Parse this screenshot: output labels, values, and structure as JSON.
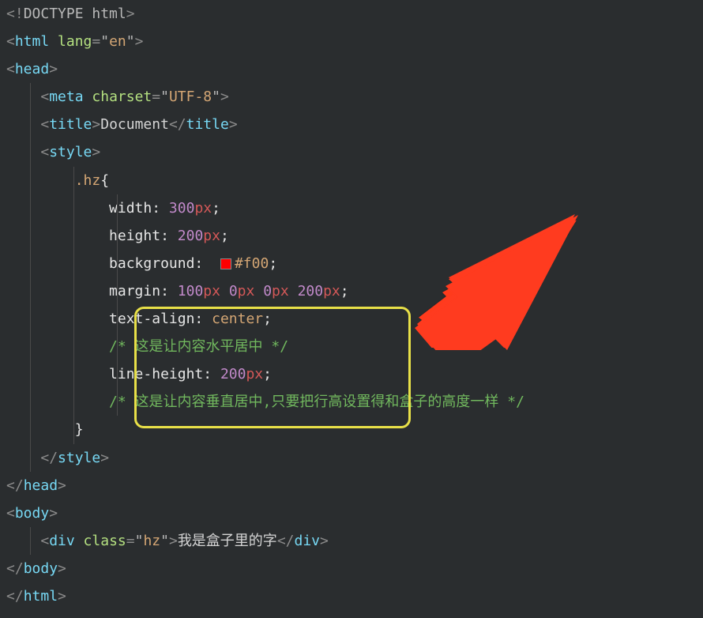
{
  "code": {
    "line1": {
      "open": "<!",
      "doctype": "DOCTYPE",
      "html": " html",
      "close": ">"
    },
    "line2": {
      "open": "<",
      "tag": "html",
      "attr": " lang",
      "eq": "=",
      "q1": "\"",
      "val": "en",
      "q2": "\"",
      "close": ">"
    },
    "line3": {
      "open": "<",
      "tag": "head",
      "close": ">"
    },
    "line4": {
      "open": "<",
      "tag": "meta",
      "attr": " charset",
      "eq": "=",
      "q1": "\"",
      "val": "UTF-8",
      "q2": "\"",
      "close": ">"
    },
    "line5": {
      "open": "<",
      "tag1": "title",
      "close1": ">",
      "text": "Document",
      "open2": "</",
      "tag2": "title",
      "close2": ">"
    },
    "line6": {
      "open": "<",
      "tag": "style",
      "close": ">"
    },
    "line7": {
      "sel": ".hz",
      "brace": "{"
    },
    "line8": {
      "prop": "width",
      "colon": ":",
      "sp": " ",
      "num": "300",
      "unit": "px",
      "semi": ";"
    },
    "line9": {
      "prop": "height",
      "colon": ":",
      "sp": " ",
      "num": "200",
      "unit": "px",
      "semi": ";"
    },
    "line10": {
      "prop": "background",
      "colon": ":",
      "sp": "  ",
      "color": "#f00",
      "semi": ";"
    },
    "line11": {
      "prop": "margin",
      "colon": ":",
      "sp": " ",
      "n1": "100",
      "u1": "px",
      "s1": " ",
      "n2": "0",
      "u2": "px",
      "s2": " ",
      "n3": "0",
      "u3": "px",
      "s3": " ",
      "n4": "200",
      "u4": "px",
      "semi": ";"
    },
    "line12": {
      "prop": "text-align",
      "colon": ":",
      "sp": " ",
      "val": "center",
      "semi": ";"
    },
    "line13": {
      "comment": "/* 这是让内容水平居中 */"
    },
    "line14": {
      "prop": "line-height",
      "colon": ":",
      "sp": " ",
      "num": "200",
      "unit": "px",
      "semi": ";"
    },
    "line15": {
      "comment": "/* 这是让内容垂直居中,只要把行高设置得和盒子的高度一样 */"
    },
    "line16": {
      "brace": "}"
    },
    "line17": {
      "open": "</",
      "tag": "style",
      "close": ">"
    },
    "line18": {
      "open": "</",
      "tag": "head",
      "close": ">"
    },
    "line19": {
      "open": "<",
      "tag": "body",
      "close": ">"
    },
    "line20": {
      "open": "<",
      "tag1": "div",
      "attr": " class",
      "eq": "=",
      "q1": "\"",
      "val": "hz",
      "q2": "\"",
      "close1": ">",
      "text": "我是盒子里的字",
      "open2": "</",
      "tag2": "div",
      "close2": ">"
    },
    "line21": {
      "open": "</",
      "tag": "body",
      "close": ">"
    },
    "line22": {
      "open": "</",
      "tag": "html",
      "close": ">"
    }
  },
  "annotation": {
    "highlight_color": "#e8e048",
    "arrow_color": "#ff3b1f"
  }
}
